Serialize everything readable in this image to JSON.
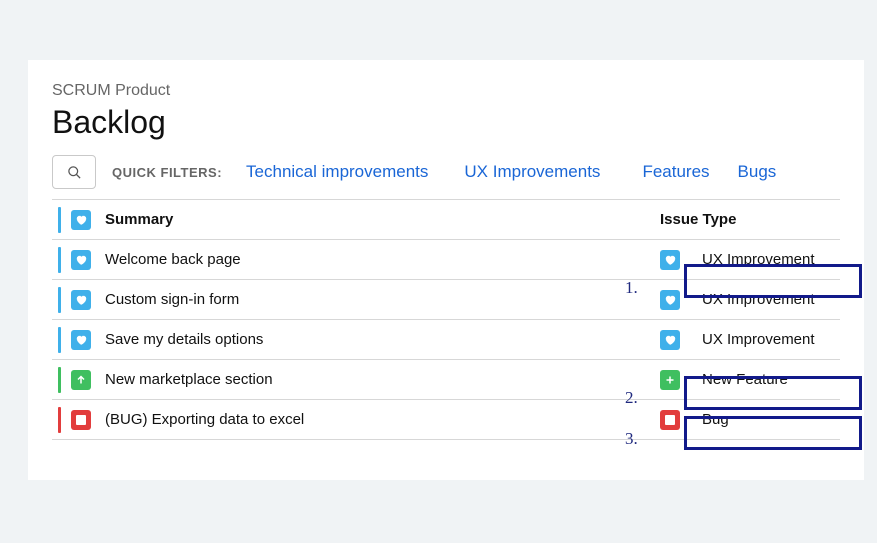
{
  "header": {
    "project": "SCRUM Product",
    "title": "Backlog"
  },
  "filters": {
    "label": "QUICK FILTERS:",
    "links": [
      "Technical improvements",
      "UX Improvements",
      "Features",
      "Bugs"
    ]
  },
  "columns": {
    "summary": "Summary",
    "issue_type": "Issue Type"
  },
  "rows": [
    {
      "summary": "Welcome back page",
      "type_label": "UX Improvement",
      "type": "ux"
    },
    {
      "summary": "Custom sign-in form",
      "type_label": "UX Improvement",
      "type": "ux"
    },
    {
      "summary": "Save my details options",
      "type_label": "UX Improvement",
      "type": "ux"
    },
    {
      "summary": "New marketplace section",
      "type_label": "New Feature",
      "type": "feat"
    },
    {
      "summary": "(BUG) Exporting data to excel",
      "type_label": "Bug",
      "type": "bug"
    }
  ],
  "annotations": {
    "a1": "1.",
    "a2": "2.",
    "a3": "3."
  }
}
